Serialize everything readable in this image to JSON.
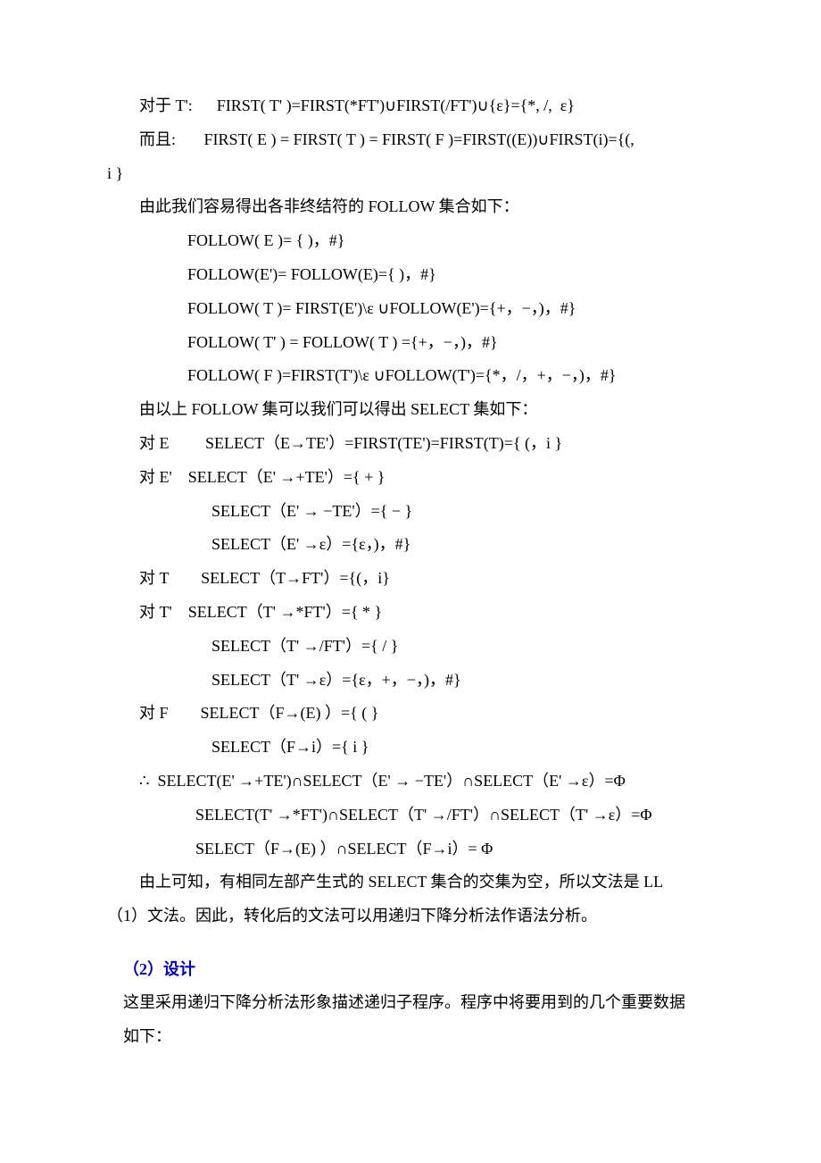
{
  "lines": {
    "l1": "对于 T':      FIRST( T' )=FIRST(*FT')∪FIRST(/FT')∪{ε}={*, /,  ε}",
    "l2": "而且:       FIRST( E ) = FIRST( T ) = FIRST( F )=FIRST((E))∪FIRST(i)={(,",
    "l3": "i }",
    "l4": "由此我们容易得出各非终结符的 FOLLOW 集合如下：",
    "l5": "FOLLOW( E )= { )，#}",
    "l6": "FOLLOW(E')= FOLLOW(E)={ )，#}",
    "l7": "FOLLOW( T )= FIRST(E')\\ε ∪FOLLOW(E')={+，−，)，#}",
    "l8": "FOLLOW( T' ) = FOLLOW( T ) ={+，−，)，#}",
    "l9": "FOLLOW( F )=FIRST(T')\\ε ∪FOLLOW(T')={*，/，+，−，)，#}",
    "l10": "由以上 FOLLOW 集可以我们可以得出 SELECT 集如下：",
    "l11": "对 E         SELECT（E→TE'）=FIRST(TE')=FIRST(T)={ (，i }",
    "l12": "对 E'    SELECT（E' →+TE'）={ + }",
    "l13": "SELECT（E' → −TE'）={ − }",
    "l14": "SELECT（E' →ε）={ε，)，#}",
    "l15": "对 T        SELECT（T→FT'）={(，i}",
    "l16": "对 T'    SELECT（T' →*FT'）={ * }",
    "l17": "SELECT（T' →/FT'）={ / }",
    "l18": "SELECT（T' →ε）={ε，+，−，)，#}",
    "l19": "对 F        SELECT（F→(E) ）={ ( }",
    "l20": "SELECT（F→i）={ i }",
    "l21": "∴  SELECT(E' →+TE')∩SELECT（E' → −TE'）∩SELECT（E' →ε）=Φ",
    "l22": "SELECT(T' →*FT')∩SELECT（T' →/FT'）∩SELECT（T' →ε）=Φ",
    "l23": "SELECT（F→(E) ）∩SELECT（F→i）= Φ",
    "l24": "由上可知，有相同左部产生式的 SELECT 集合的交集为空，所以文法是 LL",
    "l25": "（1）文法。因此，转化后的文法可以用递归下降分析法作语法分析。",
    "h2": "（2）设计",
    "p2a": "这里采用递归下降分析法形象描述递归子程序。程序中将要用到的几个重要数据",
    "p2b": "如下："
  }
}
